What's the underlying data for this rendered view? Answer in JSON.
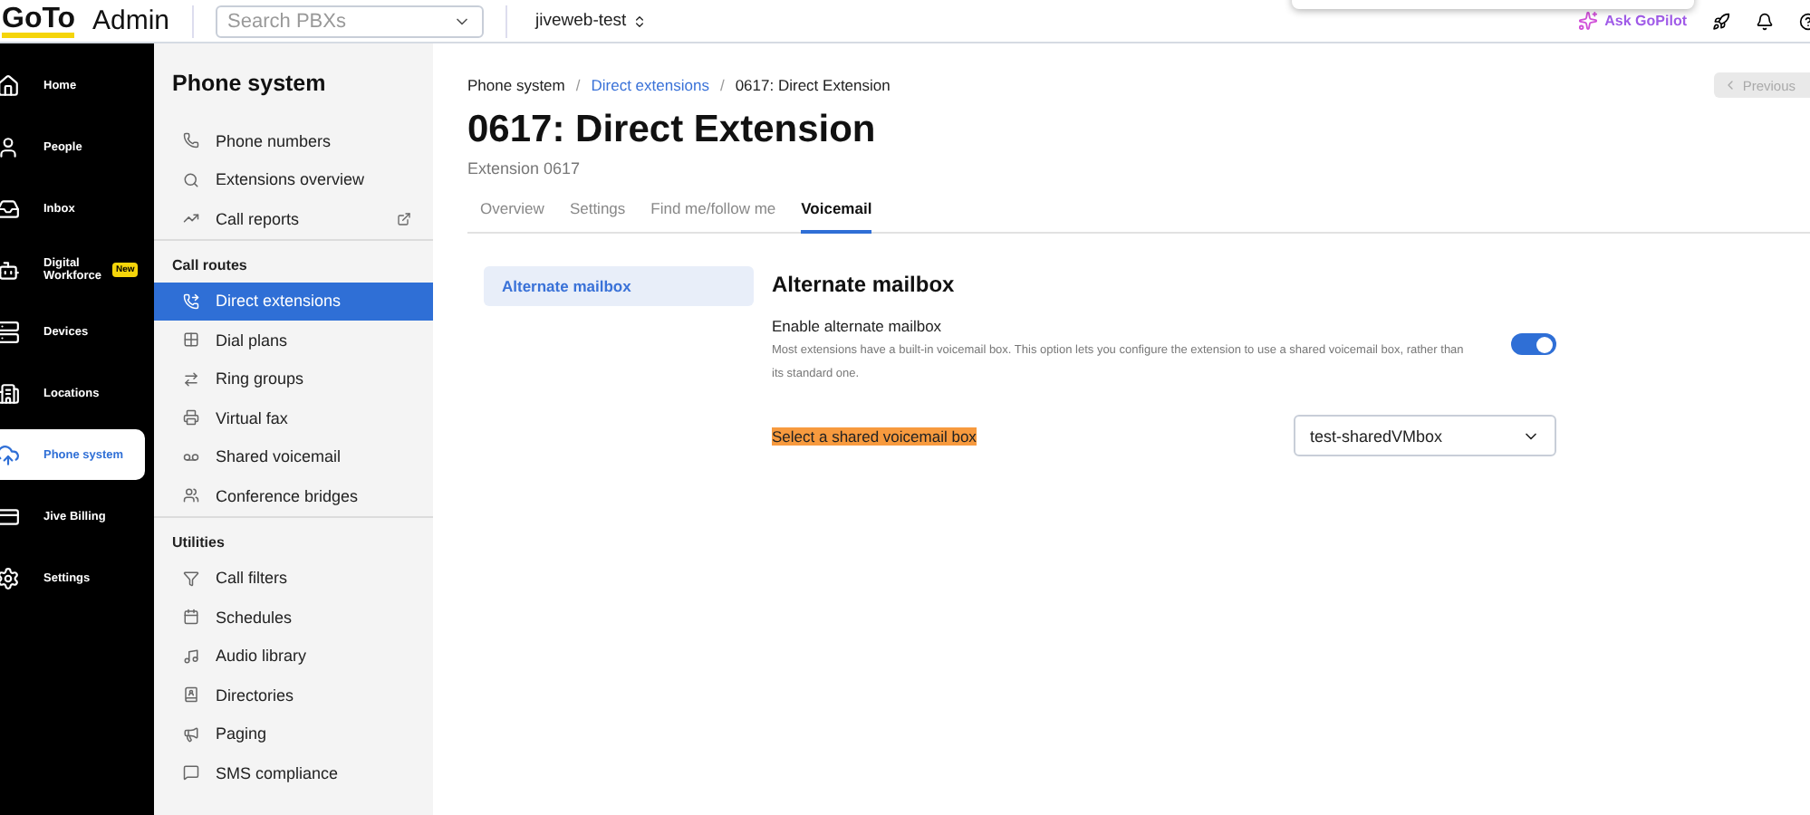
{
  "topbar": {
    "logo": "GoTo",
    "product": "Admin",
    "search": {
      "placeholder": "Search PBXs"
    },
    "account": "jiveweb-test",
    "assistant": "Ask GoPilot"
  },
  "nav": {
    "items": [
      {
        "kind": "home",
        "label": "Home",
        "selected": false
      },
      {
        "kind": "people",
        "label": "People",
        "selected": false
      },
      {
        "kind": "inbox",
        "label": "Inbox",
        "selected": false
      },
      {
        "kind": "bot",
        "label": "Digital Workforce",
        "badge": "New",
        "selected": false
      },
      {
        "kind": "devices",
        "label": "Devices",
        "selected": false
      },
      {
        "kind": "locations",
        "label": "Locations",
        "selected": false
      },
      {
        "kind": "cloud",
        "label": "Phone system",
        "selected": true
      },
      {
        "kind": "billing",
        "label": "Jive Billing",
        "selected": false
      },
      {
        "kind": "settings",
        "label": "Settings",
        "selected": false
      }
    ]
  },
  "sidebar": {
    "title": "Phone system",
    "sections": [
      {
        "items": [
          {
            "label": "Phone numbers",
            "selected": false
          },
          {
            "label": "Extensions overview",
            "selected": false
          },
          {
            "label": "Call reports",
            "external": true,
            "selected": false
          }
        ]
      },
      {
        "heading": "Call routes",
        "items": [
          {
            "label": "Direct extensions",
            "selected": true
          },
          {
            "label": "Dial plans",
            "selected": false
          },
          {
            "label": "Ring groups",
            "selected": false
          },
          {
            "label": "Virtual fax",
            "selected": false
          },
          {
            "label": "Shared voicemail",
            "selected": false
          },
          {
            "label": "Conference bridges",
            "selected": false
          }
        ]
      },
      {
        "heading": "Utilities",
        "items": [
          {
            "label": "Call filters",
            "selected": false
          },
          {
            "label": "Schedules",
            "selected": false
          },
          {
            "label": "Audio library",
            "selected": false
          },
          {
            "label": "Directories",
            "selected": false
          },
          {
            "label": "Paging",
            "selected": false
          },
          {
            "label": "SMS compliance",
            "selected": false
          }
        ]
      }
    ]
  },
  "breadcrumb": [
    {
      "label": "Phone system",
      "link": false
    },
    {
      "separator": "/",
      "label": "Direct extensions",
      "link": true
    },
    {
      "separator": "/",
      "label": "0617: Direct Extension",
      "link": false
    }
  ],
  "previous_button": "Previous",
  "title": "0617: Direct Extension",
  "subtitle": "Extension 0617",
  "tabs": [
    {
      "label": "Overview",
      "selected": false
    },
    {
      "label": "Settings",
      "selected": false
    },
    {
      "label": "Find me/follow me",
      "selected": false
    },
    {
      "label": "Voicemail",
      "selected": true
    }
  ],
  "submenu": [
    {
      "label": "Alternate mailbox",
      "selected": true
    }
  ],
  "section": {
    "heading": "Alternate mailbox",
    "toggle": {
      "label": "Enable alternate mailbox",
      "description": "Most extensions have a built-in voicemail box. This option lets you configure the extension to use a shared voicemail box, rather than its standard one.",
      "on": true
    },
    "select": {
      "label": "Select a shared voicemail box",
      "highlighted": true,
      "value": "test-sharedVMbox"
    }
  }
}
